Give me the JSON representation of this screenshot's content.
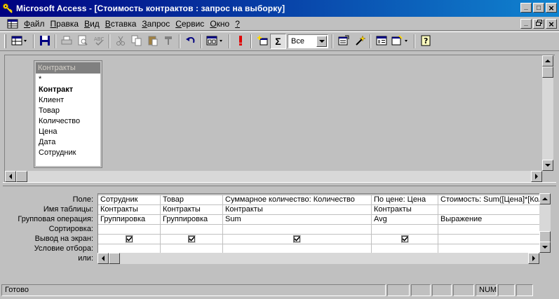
{
  "window": {
    "title": "Microsoft Access - [Стоимость контрактов : запрос на выборку]",
    "caption_buttons": {
      "minimize": "_",
      "restore": "□",
      "close": "×"
    }
  },
  "menu": {
    "items": [
      {
        "label": "Файл",
        "u": "Ф",
        "rest": "айл"
      },
      {
        "label": "Правка",
        "u": "П",
        "rest": "равка"
      },
      {
        "label": "Вид",
        "u": "В",
        "rest": "ид"
      },
      {
        "label": "Вставка",
        "u": "В",
        "rest": "ставка",
        "pre": ""
      },
      {
        "label": "Запрос",
        "u": "З",
        "rest": "апрос"
      },
      {
        "label": "Сервис",
        "u": "С",
        "rest": "ервис"
      },
      {
        "label": "Окно",
        "u": "О",
        "rest": "кно"
      },
      {
        "label": "?",
        "u": "?",
        "rest": ""
      }
    ]
  },
  "toolbar": {
    "top_values": "Все"
  },
  "field_list": {
    "title": "Контракты",
    "fields": [
      {
        "name": "*",
        "key": false
      },
      {
        "name": "Контракт",
        "key": true
      },
      {
        "name": "Клиент",
        "key": false
      },
      {
        "name": "Товар",
        "key": false
      },
      {
        "name": "Количество",
        "key": false
      },
      {
        "name": "Цена",
        "key": false
      },
      {
        "name": "Дата",
        "key": false
      },
      {
        "name": "Сотрудник",
        "key": false
      }
    ]
  },
  "grid": {
    "row_labels": [
      "Поле:",
      "Имя таблицы:",
      "Групповая операция:",
      "Сортировка:",
      "Вывод на экран:",
      "Условие отбора:",
      "или:"
    ],
    "columns": [
      {
        "field": "Сотрудник",
        "table": "Контракты",
        "total": "Группировка",
        "sort": "",
        "show": true
      },
      {
        "field": "Товар",
        "table": "Контракты",
        "total": "Группировка",
        "sort": "",
        "show": true
      },
      {
        "field": "Суммарное количество: Количество",
        "table": "Контракты",
        "total": "Sum",
        "sort": "",
        "show": true
      },
      {
        "field": "По цене: Цена",
        "table": "Контракты",
        "total": "Avg",
        "sort": "",
        "show": true
      },
      {
        "field": "Стоимость: Sum([Цена]*[Количество])",
        "table": "",
        "total": "Выражение",
        "sort": "",
        "show": false
      }
    ]
  },
  "status": {
    "text": "Готово",
    "num": "NUM"
  }
}
